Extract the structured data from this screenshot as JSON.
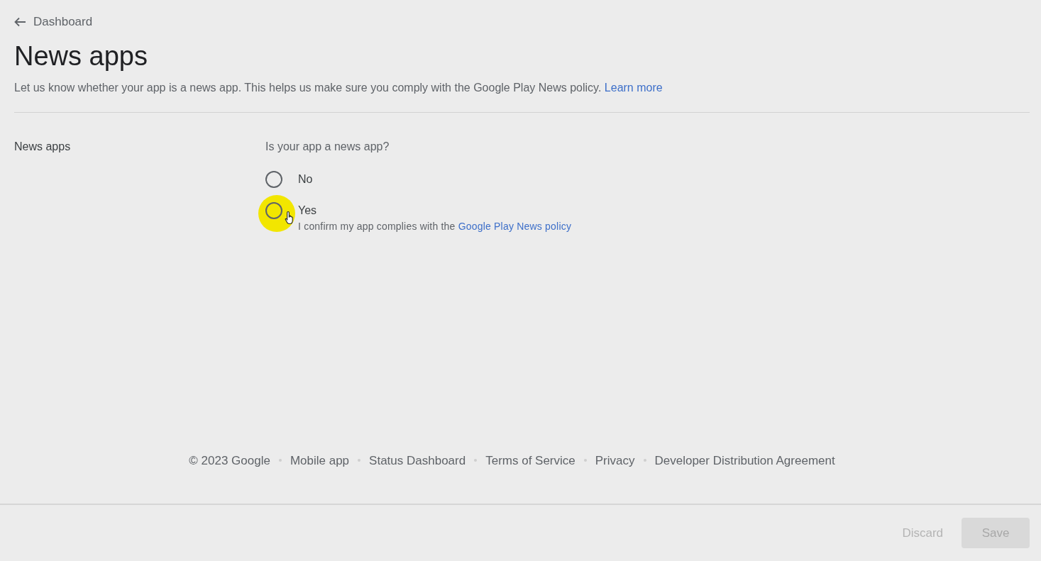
{
  "back_link": {
    "label": "Dashboard"
  },
  "title": "News apps",
  "description": {
    "text": "Let us know whether your app is a news app. This helps us make sure you comply with the Google Play News policy.",
    "link": "Learn more"
  },
  "section": {
    "label": "News apps",
    "question": "Is your app a news app?",
    "options": [
      {
        "label": "No",
        "selected": false
      },
      {
        "label": "Yes",
        "selected": false,
        "cursor_highlight": true,
        "note": "I confirm my app complies with the",
        "note_link": "Google Play News policy"
      }
    ]
  },
  "footer": [
    "© 2023 Google",
    "Mobile app",
    "Status Dashboard",
    "Terms of Service",
    "Privacy",
    "Developer Distribution Agreement"
  ],
  "actions": [
    {
      "label": "Discard",
      "kind": "text",
      "disabled": true
    },
    {
      "label": "Save",
      "kind": "filled",
      "disabled": true
    }
  ]
}
